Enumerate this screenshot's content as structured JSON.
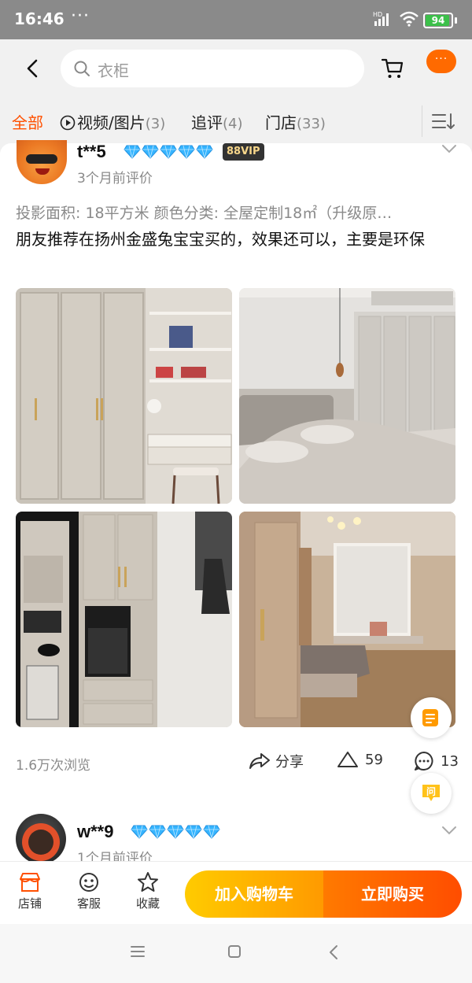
{
  "status_bar": {
    "time": "16:46",
    "dots": "···",
    "hd_label": "HD",
    "battery": "94",
    "battery_level_pct": 94,
    "battery_color": "#3cc04a"
  },
  "header": {
    "search_placeholder": "衣柜",
    "back_icon": "chevron-left-icon",
    "cart_icon": "cart-icon",
    "more_label": "···",
    "more_color": "#ff6a00"
  },
  "tabs": [
    {
      "label": "全部",
      "count": "",
      "active": true
    },
    {
      "label": "视频/图片",
      "count": "(3)",
      "active": false,
      "icon": "play-icon"
    },
    {
      "label": "追评",
      "count": "(4)",
      "active": false
    },
    {
      "label": "门店",
      "count": "(33)",
      "active": false
    }
  ],
  "accent_color": "#ff5000",
  "review1": {
    "username": "t**5",
    "diamond_count": 5,
    "vip": "88VIP",
    "time_ago": "3个月前评价",
    "spec": "投影面积: 18平方米  颜色分类: 全屋定制18㎡（升级原…",
    "text": "朋友推荐在扬州金盛兔宝宝买的，效果还可以，主要是环保",
    "photos": [
      "wardrobe-desk-photo",
      "bedroom-bed-photo",
      "kitchen-cabinet-photo",
      "bedroom-window-photo"
    ],
    "views": "1.6万次浏览",
    "share_label": "分享",
    "likes": "59",
    "comments": "13"
  },
  "review2": {
    "username": "w**9",
    "diamond_count": 5,
    "time_ago": "1个月前评价"
  },
  "bottom_bar": {
    "shop_label": "店铺",
    "service_label": "客服",
    "fav_label": "收藏",
    "add_cart_label": "加入购物车",
    "buy_label": "立即购买"
  },
  "float_buttons": [
    "note-icon",
    "question-icon"
  ],
  "float_question_label": "问"
}
